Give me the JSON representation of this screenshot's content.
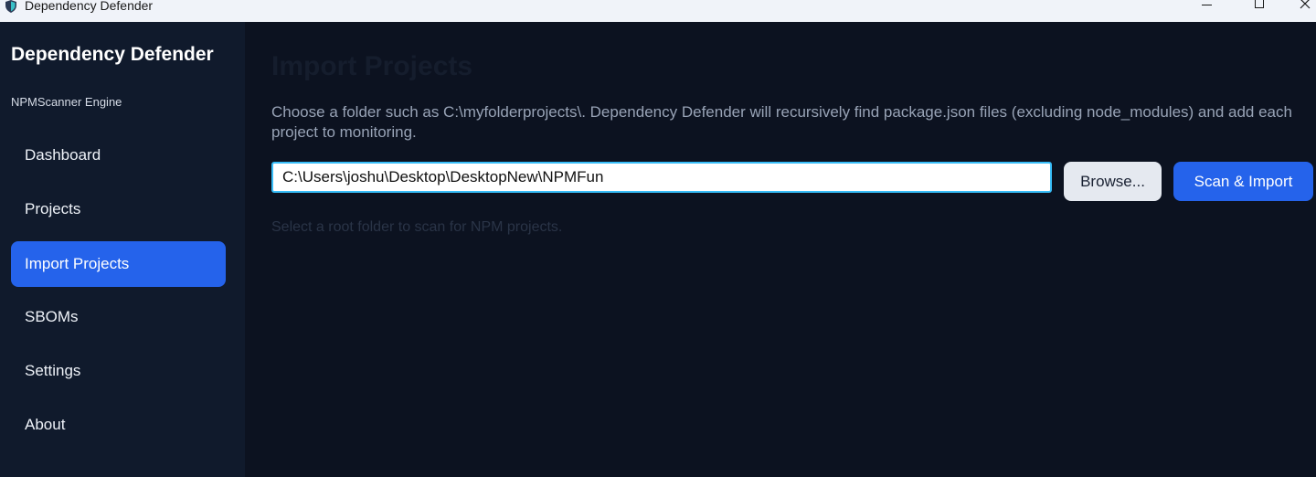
{
  "window": {
    "title": "Dependency Defender",
    "icon": "shield-icon",
    "controls": [
      "minimize-icon",
      "maximize-icon",
      "close-icon"
    ]
  },
  "sidebar": {
    "brand": "Dependency Defender",
    "subtitle": "NPMScanner Engine",
    "items": [
      {
        "label": "Dashboard",
        "active": false
      },
      {
        "label": "Projects",
        "active": false
      },
      {
        "label": "Import Projects",
        "active": true
      },
      {
        "label": "SBOMs",
        "active": false
      },
      {
        "label": "Settings",
        "active": false
      },
      {
        "label": "About",
        "active": false
      }
    ]
  },
  "main": {
    "title": "Import Projects",
    "description": "Choose a folder such as C:\\myfolderprojects\\. Dependency Defender will recursively find package.json files (excluding node_modules) and add each project to monitoring.",
    "folder_input": {
      "value": "C:\\Users\\joshu\\Desktop\\DesktopNew\\NPMFun"
    },
    "browse_label": "Browse...",
    "scan_label": "Scan & Import",
    "hint": "Select a root folder to scan for NPM projects."
  },
  "colors": {
    "accent": "#2563eb",
    "sidebar_bg": "#101a2c",
    "content_bg": "#0c1220",
    "input_focus": "#38bdf8"
  }
}
